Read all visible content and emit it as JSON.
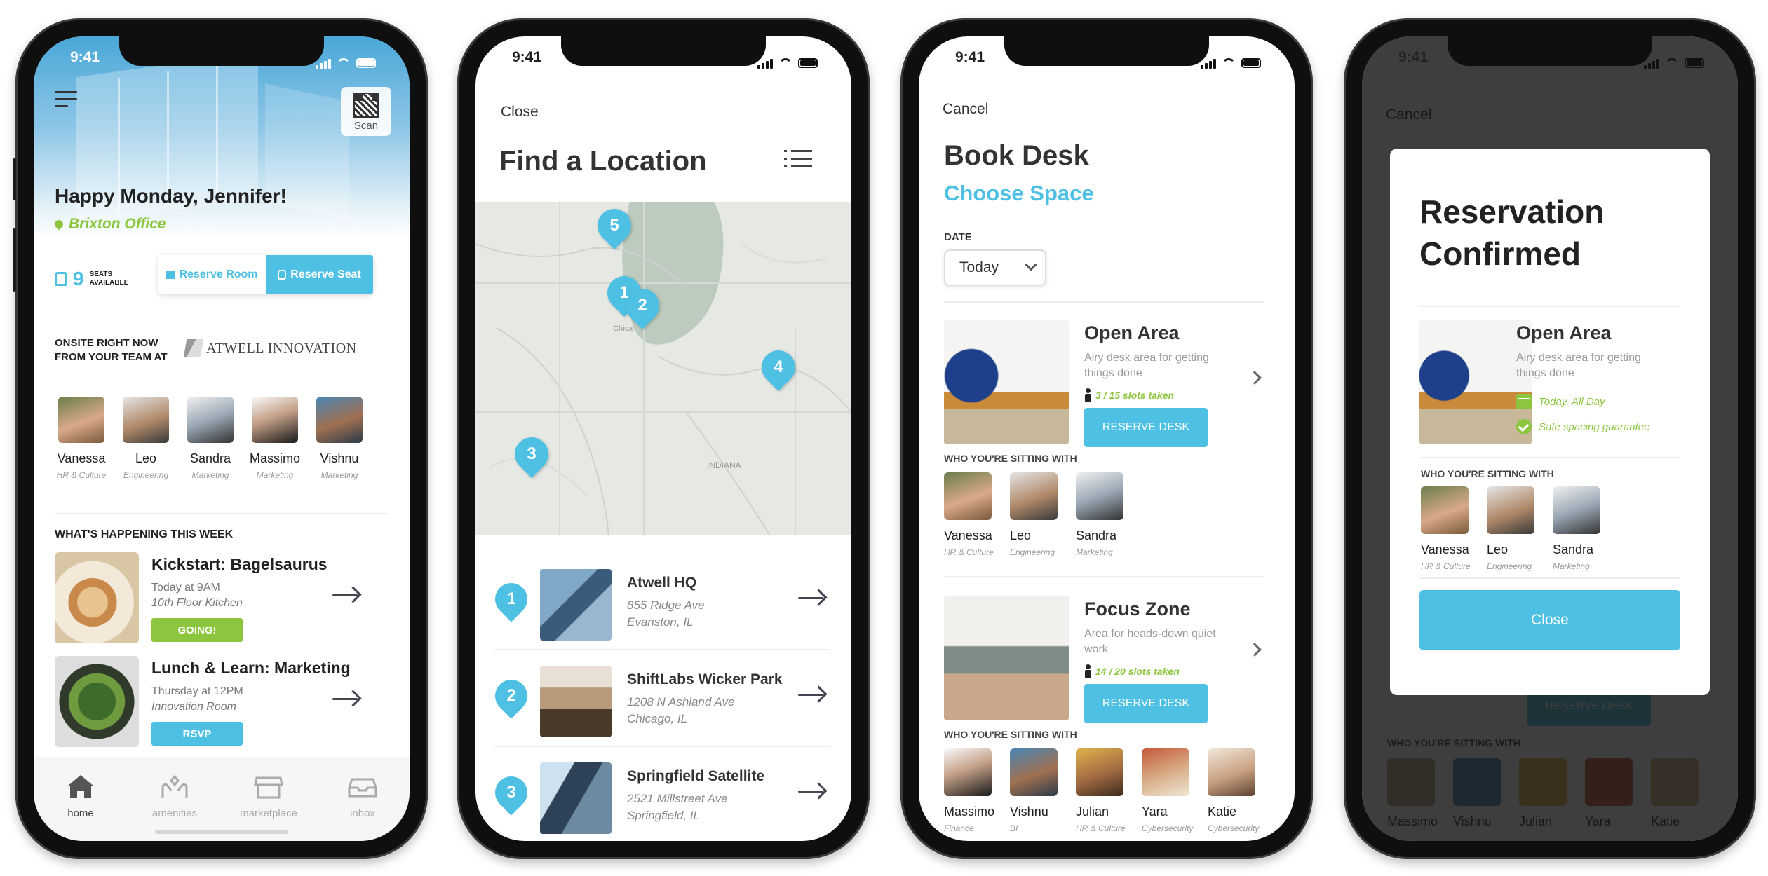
{
  "status": {
    "time": "9:41"
  },
  "phone1": {
    "scan_label": "Scan",
    "greeting": "Happy Monday, Jennifer!",
    "office": "Brixton Office",
    "seats_count": "9",
    "seats_label_1": "SEATS",
    "seats_label_2": "AVAILABLE",
    "reserve_room": "Reserve Room",
    "reserve_seat": "Reserve Seat",
    "onsite_line1": "ONSITE RIGHT NOW",
    "onsite_line2": "FROM YOUR TEAM AT",
    "company": "ATWELL INNOVATION",
    "team": [
      {
        "name": "Vanessa",
        "role": "HR & Culture"
      },
      {
        "name": "Leo",
        "role": "Engineering"
      },
      {
        "name": "Sandra",
        "role": "Marketing"
      },
      {
        "name": "Massimo",
        "role": "Marketing"
      },
      {
        "name": "Vishnu",
        "role": "Marketing"
      }
    ],
    "week_heading": "WHAT'S HAPPENING THIS WEEK",
    "events": [
      {
        "title": "Kickstart: Bagelsaurus",
        "when": "Today at 9AM",
        "where": "10th Floor Kitchen",
        "action": "GOING!"
      },
      {
        "title": "Lunch & Learn: Marketing",
        "when": "Thursday at 12PM",
        "where": "Innovation Room",
        "action": "RSVP"
      }
    ],
    "tabs": [
      "home",
      "amenities",
      "marketplace",
      "inbox"
    ]
  },
  "phone2": {
    "close": "Close",
    "title": "Find a Location",
    "map_pins": [
      "5",
      "1",
      "2",
      "4",
      "3"
    ],
    "locations": [
      {
        "num": "1",
        "name": "Atwell HQ",
        "addr1": "855 Ridge Ave",
        "addr2": "Evanston, IL"
      },
      {
        "num": "2",
        "name": "ShiftLabs Wicker Park",
        "addr1": "1208 N Ashland Ave",
        "addr2": "Chicago, IL"
      },
      {
        "num": "3",
        "name": "Springfield Satellite",
        "addr1": "2521 Millstreet Ave",
        "addr2": "Springfield, IL"
      }
    ]
  },
  "phone3": {
    "cancel": "Cancel",
    "title": "Book Desk",
    "subtitle": "Choose Space",
    "date_label": "DATE",
    "date_value": "Today",
    "sitting_with": "WHO YOU'RE SITTING WITH",
    "reserve_btn": "RESERVE DESK",
    "spaces": [
      {
        "name": "Open Area",
        "desc": "Airy desk area for getting things done",
        "slots": "3 / 15 slots taken"
      },
      {
        "name": "Focus Zone",
        "desc": "Area for heads-down quiet work",
        "slots": "14 / 20 slots taken"
      }
    ],
    "open_people": [
      {
        "name": "Vanessa",
        "role": "HR & Culture"
      },
      {
        "name": "Leo",
        "role": "Engineering"
      },
      {
        "name": "Sandra",
        "role": "Marketing"
      }
    ],
    "focus_people": [
      {
        "name": "Massimo",
        "role": "Finance"
      },
      {
        "name": "Vishnu",
        "role": "BI"
      },
      {
        "name": "Julian",
        "role": "HR & Culture"
      },
      {
        "name": "Yara",
        "role": "Cybersecurity"
      },
      {
        "name": "Katie",
        "role": "Cybersecurity"
      }
    ]
  },
  "phone4": {
    "title_line1": "Reservation",
    "title_line2": "Confirmed",
    "space_name": "Open Area",
    "space_desc": "Airy desk area for getting things done",
    "date": "Today, All Day",
    "safety": "Safe spacing guarantee",
    "sitting_with": "WHO YOU'RE SITTING WITH",
    "close": "Close",
    "people": [
      {
        "name": "Vanessa",
        "role": "HR & Culture"
      },
      {
        "name": "Leo",
        "role": "Engineering"
      },
      {
        "name": "Sandra",
        "role": "Marketing"
      }
    ]
  },
  "colors": {
    "accent": "#4ec0e4",
    "green": "#8cc63f"
  }
}
